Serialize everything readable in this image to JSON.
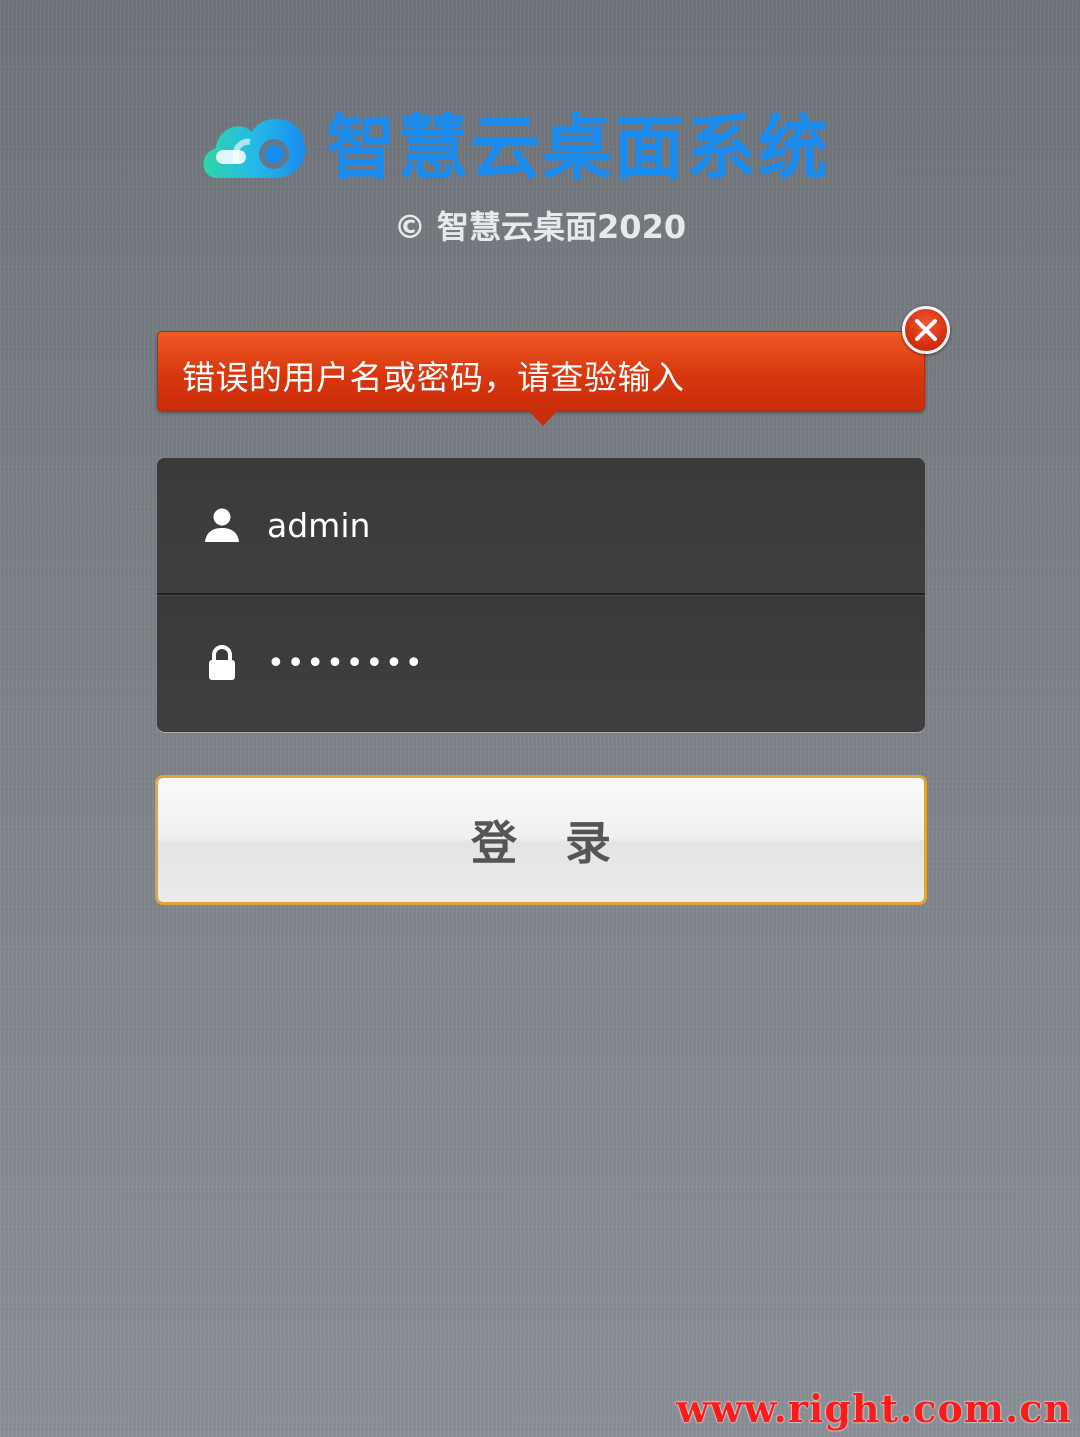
{
  "brand": {
    "logo_text": "智慧云桌面系统",
    "copyright": "© 智慧云桌面2020",
    "logo_color": "#1a8cf0"
  },
  "error": {
    "message": "错误的用户名或密码，请查验输入",
    "close_icon": "close-icon",
    "color": "#d8370f"
  },
  "login_form": {
    "username": {
      "icon": "user-icon",
      "value": "admin"
    },
    "password": {
      "icon": "lock-icon",
      "value": "••••••••"
    },
    "submit_label": "登 录"
  },
  "watermark": "www.right.com.cn"
}
